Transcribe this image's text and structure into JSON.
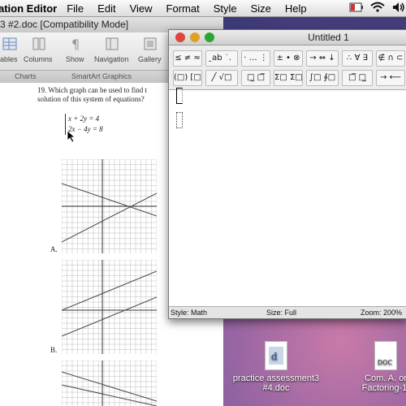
{
  "menubar": {
    "app_name": "ation Editor",
    "items": [
      "File",
      "Edit",
      "View",
      "Format",
      "Style",
      "Size",
      "Help"
    ]
  },
  "word_window": {
    "title": "3 #2.doc [Compatibility Mode]",
    "ribbon_buttons": [
      "ables",
      "Columns",
      "Show",
      "Navigation",
      "Gallery"
    ],
    "ribbon_groups": [
      "Charts",
      "SmartArt Graphics"
    ],
    "question": "19. Which graph can be used to find the solution of this system of equations?",
    "question_line1": "19. Which graph can be used to find t",
    "question_line2": "solution of this system of equations?",
    "equations": [
      "x + 2y = 4",
      "2x − 4y = 8"
    ],
    "option_labels": [
      "A.",
      "B."
    ]
  },
  "equation_editor": {
    "title": "Untitled 1",
    "palette_row1": [
      "≤ ≠ ≈",
      "̱ab ˙.",
      "‧ … ⋮",
      "± • ⊗",
      "→ ⇔ ↓",
      "∴ ∀ ∃",
      "∉ ∩ ⊂"
    ],
    "palette_row2": [
      "(□) [□]",
      "╱ √□",
      "□̲ □̅",
      "Σ□ Σ□",
      "∫□ ∮□",
      "□̅ □̲",
      "→ ⟵"
    ],
    "status": {
      "style": "Style: Math",
      "size": "Size: Full",
      "zoom": "Zoom: 200%"
    }
  },
  "desktop": {
    "icons": [
      {
        "label_line1": "practice assessment3",
        "label_line2": "#4.doc"
      },
      {
        "label_line1": "Com. A. or",
        "label_line2": "Factoring-1."
      }
    ]
  },
  "colors": {
    "close": "#e0443e",
    "minimize": "#dea123",
    "zoom": "#29a630"
  }
}
